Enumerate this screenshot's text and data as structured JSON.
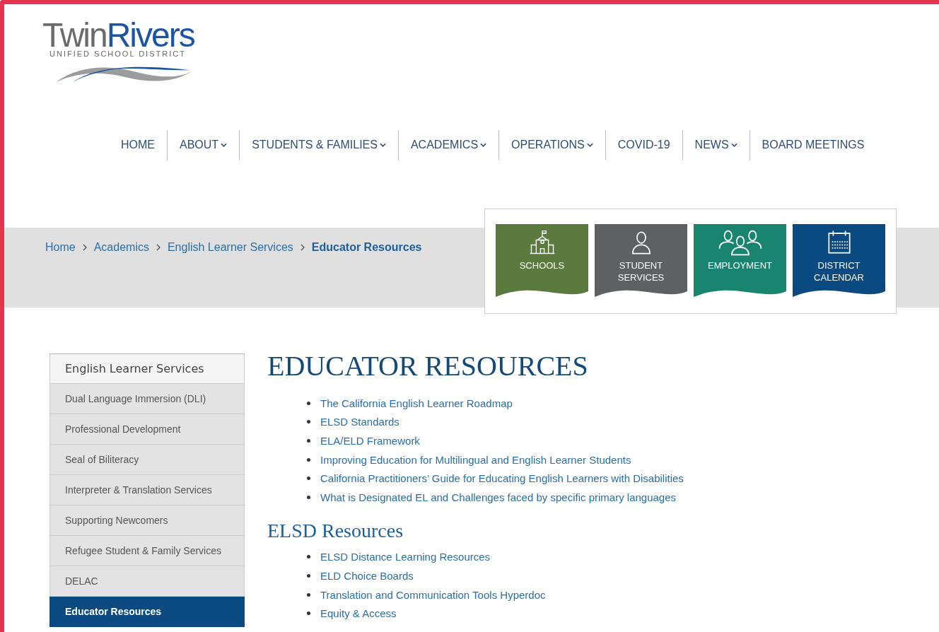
{
  "logo": {
    "title_first": "Twin",
    "title_second": "Rivers",
    "subtitle": "UNIFIED SCHOOL DISTRICT"
  },
  "nav": [
    {
      "label": "HOME",
      "dropdown": false
    },
    {
      "label": "ABOUT",
      "dropdown": true
    },
    {
      "label": "STUDENTS & FAMILIES",
      "dropdown": true
    },
    {
      "label": "ACADEMICS",
      "dropdown": true
    },
    {
      "label": "OPERATIONS",
      "dropdown": true
    },
    {
      "label": "COVID-19",
      "dropdown": false
    },
    {
      "label": "NEWS",
      "dropdown": true
    },
    {
      "label": "BOARD MEETINGS",
      "dropdown": false
    }
  ],
  "breadcrumb": [
    {
      "label": "Home",
      "current": false
    },
    {
      "label": "Academics",
      "current": false
    },
    {
      "label": "English Learner Services",
      "current": false
    },
    {
      "label": "Educator Resources",
      "current": true
    }
  ],
  "quick_links": [
    {
      "kind": "school",
      "label": "SCHOOLS",
      "color": "#5a7a3e"
    },
    {
      "kind": "person",
      "label": "STUDENT SERVICES",
      "color": "#5f6062"
    },
    {
      "kind": "group",
      "label": "EMPLOYMENT",
      "color": "#19846f"
    },
    {
      "kind": "calendar",
      "label": "DISTRICT CALENDAR",
      "color": "#0b4a80"
    }
  ],
  "sidebar": {
    "heading": "English Learner Services",
    "items": [
      {
        "label": "Dual Language Immersion (DLI)",
        "selected": false
      },
      {
        "label": "Professional Development",
        "selected": false
      },
      {
        "label": "Seal of Biliteracy",
        "selected": false
      },
      {
        "label": "Interpreter & Translation Services",
        "selected": false
      },
      {
        "label": "Supporting Newcomers",
        "selected": false
      },
      {
        "label": "Refugee Student & Family Services",
        "selected": false
      },
      {
        "label": "DELAC",
        "selected": false
      },
      {
        "label": "Educator Resources",
        "selected": true
      }
    ]
  },
  "content": {
    "title": "EDUCATOR RESOURCES",
    "sections": [
      {
        "links": [
          "The California English Learner Roadmap",
          "ELSD Standards",
          "ELA/ELD Framework",
          "Improving Education for Multilingual and English Learner Students",
          "California Practitioners’ Guide for Educating English Learners with Disabilities",
          "What is Designated EL and Challenges faced by specific primary languages"
        ]
      },
      {
        "heading": "ELSD Resources",
        "links": [
          "ELSD Distance Learning Resources",
          "ELD Choice Boards",
          "Translation and Communication Tools Hyperdoc",
          "Equity & Access"
        ]
      }
    ]
  }
}
